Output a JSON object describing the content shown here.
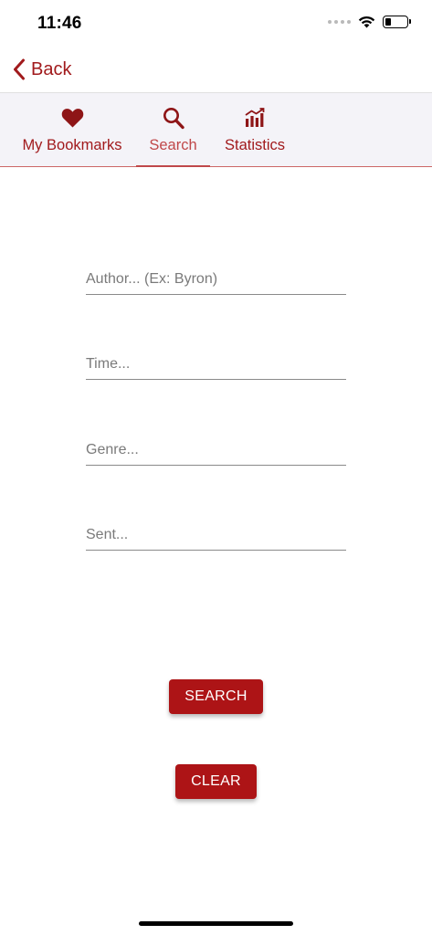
{
  "status_bar": {
    "time": "11:46",
    "battery_level": 0.25
  },
  "nav": {
    "back_label": "Back",
    "back_icon": "chevron-left-icon"
  },
  "tabs": [
    {
      "label": "My Bookmarks",
      "icon": "heart-icon",
      "selected": false
    },
    {
      "label": "Search",
      "icon": "search-icon",
      "selected": true
    },
    {
      "label": "Statistics",
      "icon": "bar-chart-icon",
      "selected": false
    }
  ],
  "form": {
    "author_placeholder": "Author... (Ex: Byron)",
    "time_placeholder": "Time...",
    "genre_placeholder": "Genre...",
    "sent_placeholder": "Sent...",
    "author_value": "",
    "time_value": "",
    "genre_value": "",
    "sent_value": ""
  },
  "buttons": {
    "search_label": "SEARCH",
    "clear_label": "CLEAR"
  },
  "colors": {
    "accent": "#a11a1c",
    "button_bg": "#ad1416",
    "selected_tab": "#c0484a",
    "tab_bar_bg": "#f4f3f8"
  }
}
